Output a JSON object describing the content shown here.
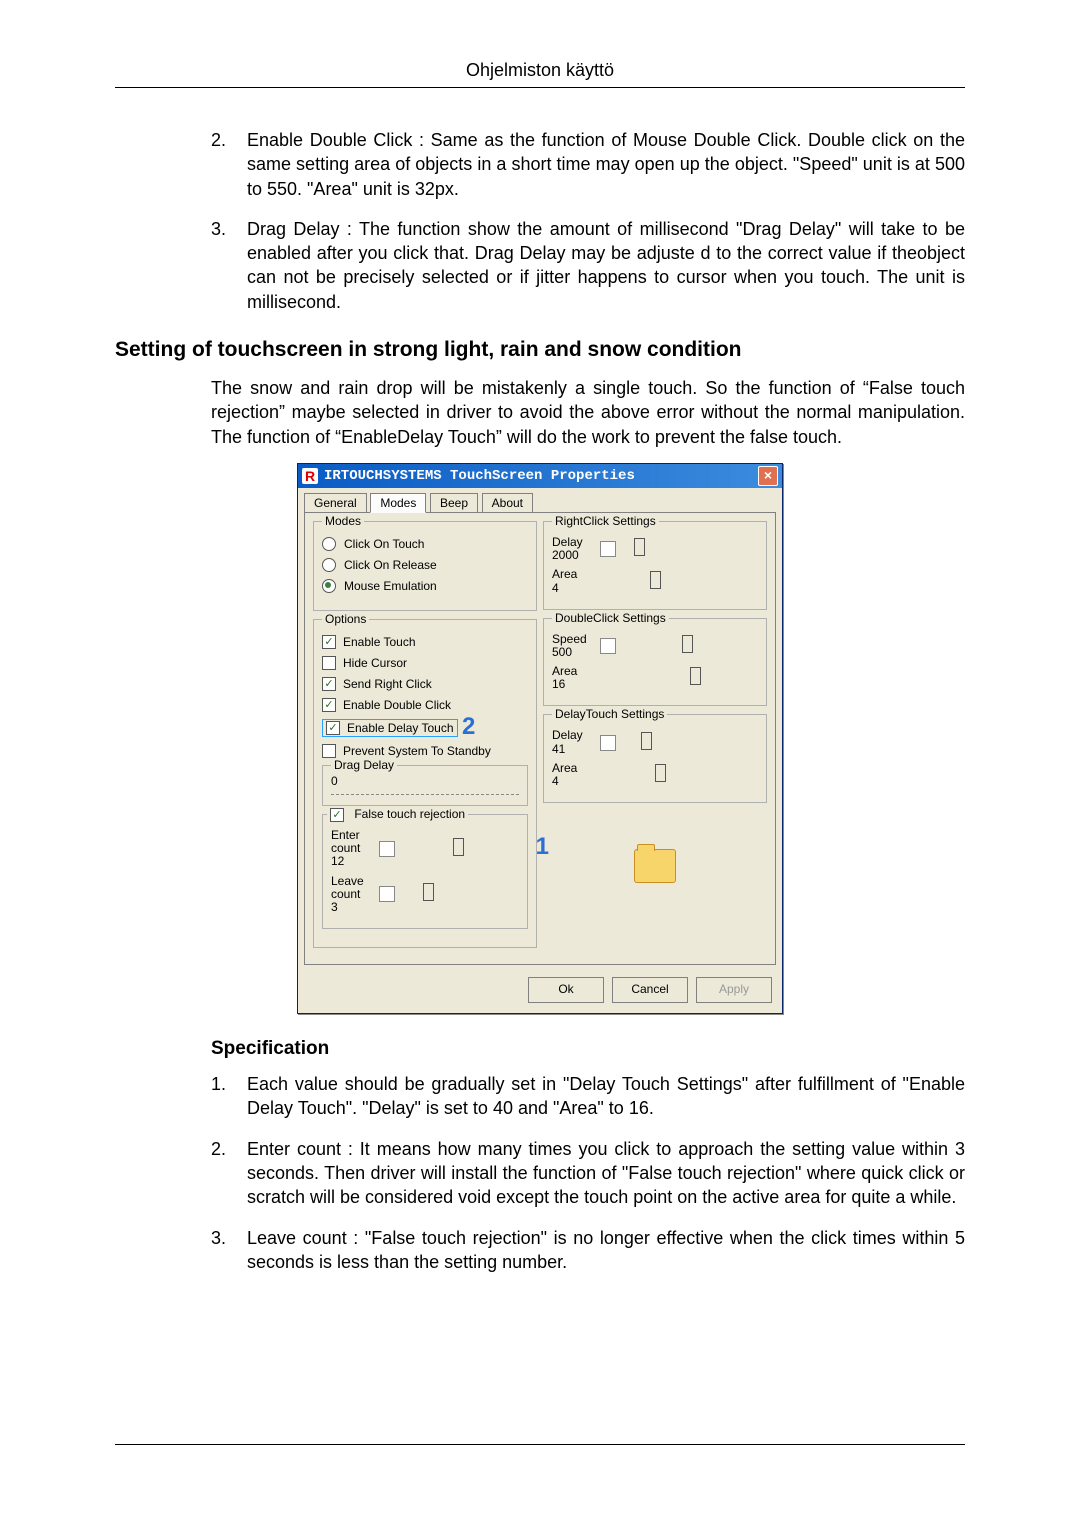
{
  "header": "Ohjelmiston käyttö",
  "top_list": [
    {
      "n": "2.",
      "t": "Enable Double Click : Same as the function of Mouse Double Click. Double click on the same setting area of objects in a short time may open up the object. \"Speed\" unit is at 500 to 550. \"Area\" unit is 32px."
    },
    {
      "n": "3.",
      "t": "Drag Delay : The function show the amount of millisecond \"Drag Delay\" will take to be enabled after you click that. Drag Delay may be adjuste d to the correct value if theobject can not be precisely selected or if jitter happens to cursor when you touch. The unit is millisecond."
    }
  ],
  "section_heading": "Setting of touchscreen in strong light, rain and snow condition",
  "section_para": "The snow and rain drop will be mistakenly a single touch. So the function of “False touch rejection” maybe selected in driver to avoid the above error without the normal manipulation. The function of “EnableDelay Touch” will do the work to prevent the false touch.",
  "dlg": {
    "title": "IRTOUCHSYSTEMS TouchScreen Properties",
    "icon": "R",
    "tabs": [
      "General",
      "Modes",
      "Beep",
      "About"
    ],
    "active_tab": 1,
    "groups": {
      "modes": {
        "title": "Modes",
        "items": [
          "Click On Touch",
          "Click On Release",
          "Mouse Emulation"
        ],
        "selected": 2
      },
      "options": {
        "title": "Options",
        "items": [
          {
            "label": "Enable Touch",
            "checked": true
          },
          {
            "label": "Hide Cursor",
            "checked": false
          },
          {
            "label": "Send Right Click",
            "checked": true
          },
          {
            "label": "Enable Double Click",
            "checked": true
          },
          {
            "label": "Enable Delay Touch",
            "checked": true,
            "highlight": true,
            "callout": "2"
          },
          {
            "label": "Prevent System To Standby",
            "checked": false
          }
        ]
      },
      "drag_delay": {
        "title": "Drag Delay",
        "value": "0"
      },
      "false_touch": {
        "title_label": "False touch rejection",
        "checked": true,
        "enter_label": "Enter count",
        "enter_value": "12",
        "leave_label": "Leave count",
        "leave_value": "3",
        "callout": "1"
      },
      "right_click": {
        "title": "RightClick Settings",
        "delay_label": "Delay",
        "delay_value": "2000",
        "area_label": "Area",
        "area_value": "4"
      },
      "double_click": {
        "title": "DoubleClick Settings",
        "speed_label": "Speed",
        "speed_value": "500",
        "area_label": "Area",
        "area_value": "16"
      },
      "delay_touch": {
        "title": "DelayTouch Settings",
        "delay_label": "Delay",
        "delay_value": "41",
        "area_label": "Area",
        "area_value": "4"
      }
    },
    "buttons": {
      "ok": "Ok",
      "cancel": "Cancel",
      "apply": "Apply"
    }
  },
  "spec_heading": "Specification",
  "spec_list": [
    {
      "n": "1.",
      "t": "Each value should be gradually set in \"Delay Touch Settings\" after fulfillment of \"Enable Delay Touch\". \"Delay\" is set to 40 and \"Area\" to 16."
    },
    {
      "n": "2.",
      "t": "Enter count : It means how many times you click to approach the setting value within 3 seconds. Then driver will install the function of \"False touch rejection\" where quick click or scratch will be considered void except the touch point on the active area for quite a while."
    },
    {
      "n": "3.",
      "t": "Leave count : \"False touch rejection\" is no longer effective when the click times within 5 seconds is less than the setting number."
    }
  ]
}
